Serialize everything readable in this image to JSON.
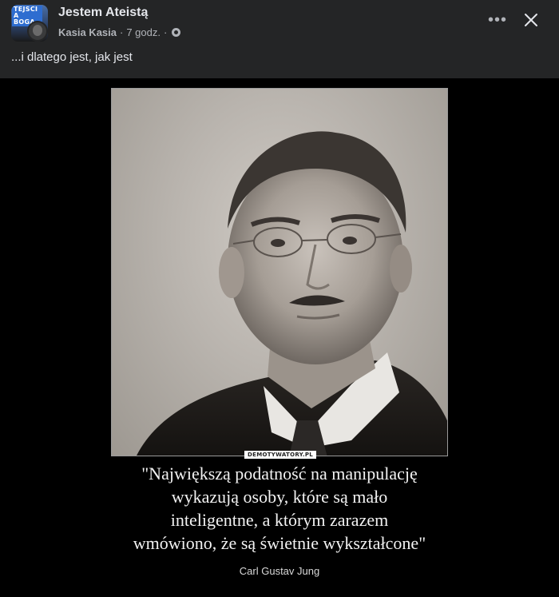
{
  "header": {
    "avatar_text": "TEJSCI A BOGA",
    "group_name": "Jestem Ateistą",
    "author": "Kasia Kasia",
    "separator": "·",
    "time": "7 godz.",
    "privacy_icon": "globe-icon",
    "more_label": "•••",
    "close_icon": "close-icon"
  },
  "post": {
    "text": "...i dlatego jest, jak jest"
  },
  "media": {
    "watermark": "DEMOTYWATORY.PL",
    "quote_lines": [
      "\"Największą podatność na manipulację",
      "wykazują osoby, które są mało",
      "inteligentne, a którym zarazem",
      "wmówiono, że są świetnie wykształcone\""
    ],
    "quote_author": "Carl Gustav Jung"
  },
  "colors": {
    "background": "#242526",
    "media_background": "#000000",
    "primary_text": "#e4e6eb",
    "secondary_text": "#b0b3b8"
  }
}
